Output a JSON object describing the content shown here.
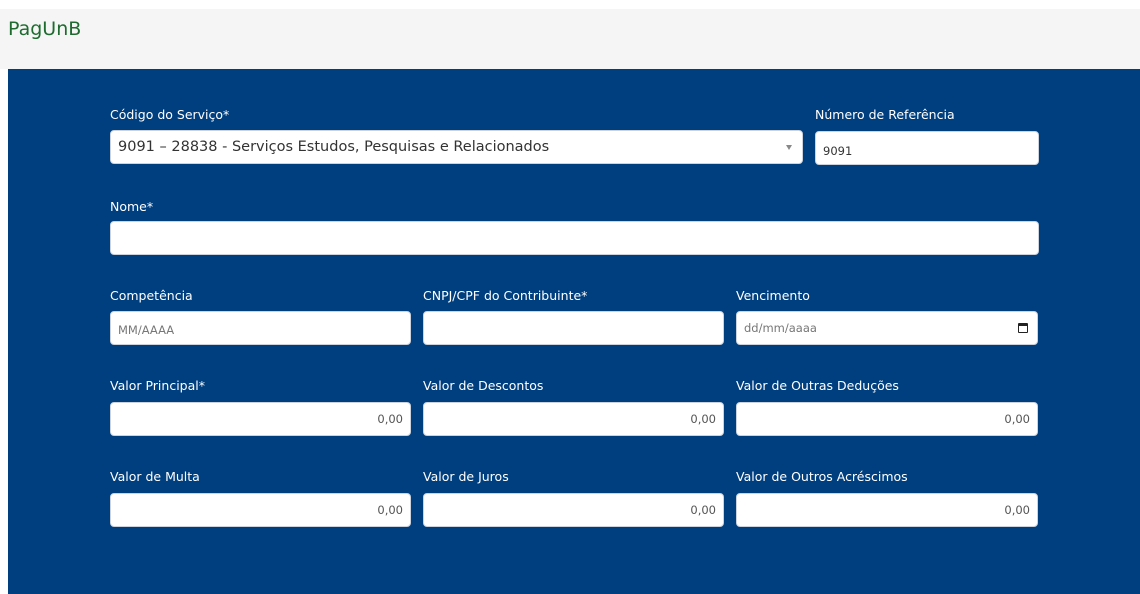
{
  "header": {
    "brand": "PagUnB"
  },
  "form": {
    "codigo_servico": {
      "label": "Código do Serviço*",
      "value": "9091 – 28838 - Serviços Estudos, Pesquisas e Relacionados"
    },
    "numero_referencia": {
      "label": "Número de Referência",
      "value": "9091"
    },
    "nome": {
      "label": "Nome*",
      "value": ""
    },
    "competencia": {
      "label": "Competência",
      "placeholder": "MM/AAAA"
    },
    "cnpj_cpf": {
      "label": "CNPJ/CPF do Contribuinte*",
      "value": ""
    },
    "vencimento": {
      "label": "Vencimento",
      "placeholder": "dd/mm/aaaa"
    },
    "valor_principal": {
      "label": "Valor Principal*",
      "value": "0,00"
    },
    "valor_descontos": {
      "label": "Valor de Descontos",
      "value": "0,00"
    },
    "valor_outras_deducoes": {
      "label": "Valor de Outras Deduções",
      "value": "0,00"
    },
    "valor_multa": {
      "label": "Valor de Multa",
      "value": "0,00"
    },
    "valor_juros": {
      "label": "Valor de Juros",
      "value": "0,00"
    },
    "valor_outros_acrescimos": {
      "label": "Valor de Outros Acréscimos",
      "value": "0,00"
    }
  }
}
